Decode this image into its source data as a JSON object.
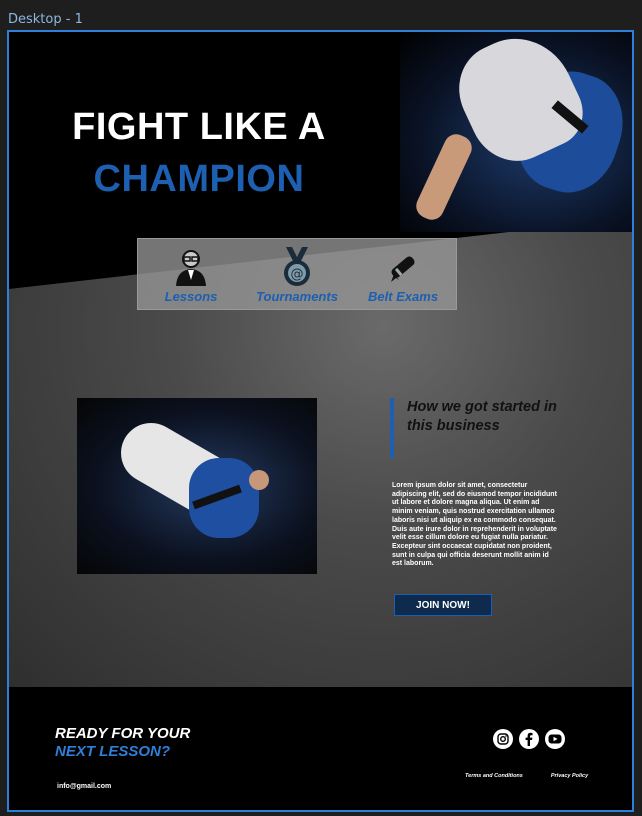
{
  "editor": {
    "frame_label": "Desktop - 1"
  },
  "hero": {
    "title_line1": "FIGHT LIKE A",
    "title_line2": "CHAMPION"
  },
  "services": [
    {
      "label": "Lessons",
      "icon": "coach-icon"
    },
    {
      "label": "Tournaments",
      "icon": "medal-icon"
    },
    {
      "label": "Belt Exams",
      "icon": "diploma-icon"
    }
  ],
  "about": {
    "heading": "How we got started in this business",
    "body": "Lorem ipsum dolor sit amet, consectetur adipiscing elit, sed do eiusmod tempor incididunt ut labore et dolore magna aliqua. Ut enim ad minim veniam, quis nostrud exercitation ullamco laboris nisi ut aliquip ex ea commodo consequat. Duis aute irure dolor in reprehenderit in voluptate velit esse cillum dolore eu fugiat nulla pariatur. Excepteur sint occaecat cupidatat non proident, sunt in culpa qui officia deserunt mollit anim id est laborum.",
    "cta_label": "JOIN NOW!"
  },
  "footer": {
    "ready_line1": "READY FOR YOUR",
    "ready_line2": "NEXT LESSON?",
    "email": "info@gmail.com",
    "socials": [
      "instagram-icon",
      "facebook-icon",
      "youtube-icon"
    ],
    "links": [
      "Terms and Conditions",
      "Privacy Policy"
    ]
  },
  "colors": {
    "accent": "#1d5fb0",
    "frame_border": "#2e7fd9",
    "footer_bg": "#000000"
  }
}
